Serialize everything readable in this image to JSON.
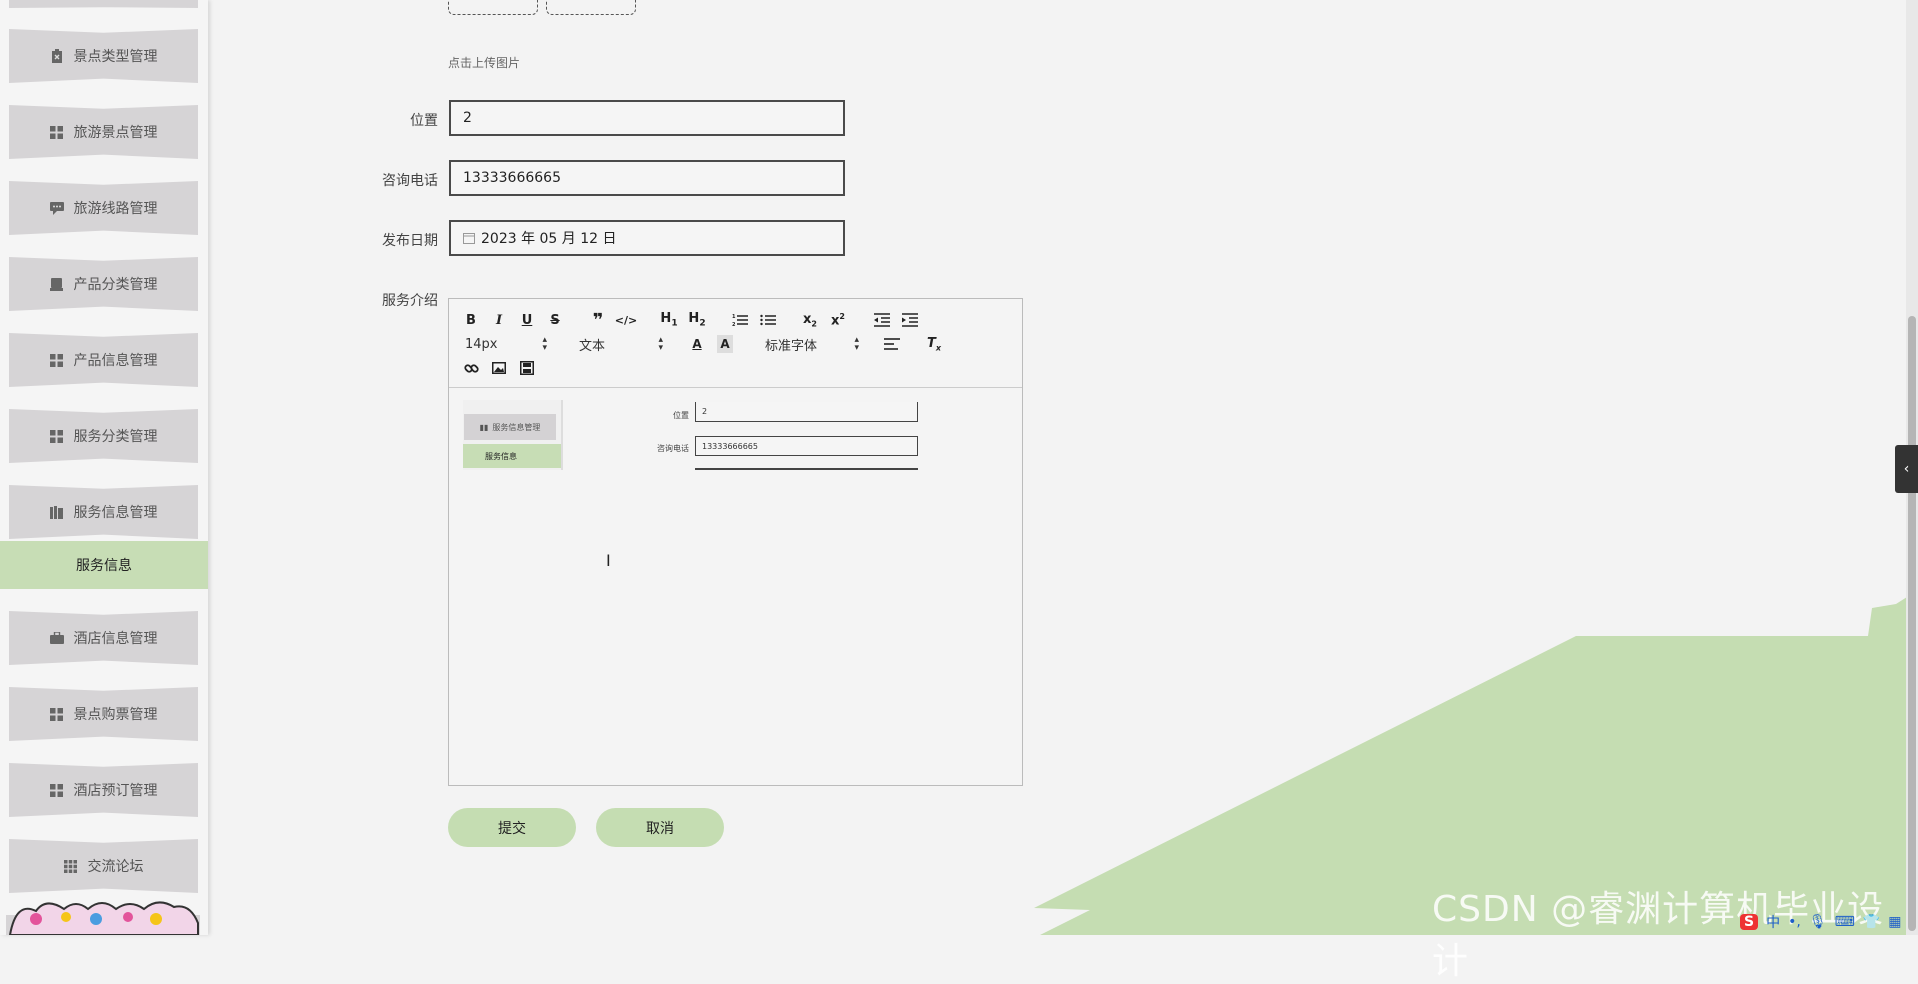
{
  "sidebar": {
    "items": [
      {
        "label": "景点类型管理",
        "icon": "clipboard-icon"
      },
      {
        "label": "旅游景点管理",
        "icon": "grid-icon"
      },
      {
        "label": "旅游线路管理",
        "icon": "comment-icon"
      },
      {
        "label": "产品分类管理",
        "icon": "box-icon"
      },
      {
        "label": "产品信息管理",
        "icon": "grid-icon"
      },
      {
        "label": "服务分类管理",
        "icon": "grid-icon"
      },
      {
        "label": "服务信息管理",
        "icon": "book-icon"
      },
      {
        "label": "酒店信息管理",
        "icon": "briefcase-icon"
      },
      {
        "label": "景点购票管理",
        "icon": "grid-icon"
      },
      {
        "label": "酒店预订管理",
        "icon": "grid-icon"
      },
      {
        "label": "交流论坛",
        "icon": "apps-icon"
      }
    ],
    "active_sub": "服务信息"
  },
  "form": {
    "upload_hint": "点击上传图片",
    "location_label": "位置",
    "location_value": "2",
    "phone_label": "咨询电话",
    "phone_value": "13333666665",
    "date_label": "发布日期",
    "date_value": "2023 年 05 月 12 日",
    "intro_label": "服务介绍"
  },
  "editor": {
    "font_size": "14px",
    "block_format": "文本",
    "font_family": "标准字体",
    "embedded": {
      "menu_item": "服务信息管理",
      "sub_item": "服务信息",
      "location_label": "位置",
      "location_value": "2",
      "phone_label": "咨询电话",
      "phone_value": "13333666665"
    }
  },
  "buttons": {
    "submit": "提交",
    "cancel": "取消"
  },
  "watermark": "CSDN @睿渊计算机毕业设计",
  "tray": {
    "ime_logo": "S",
    "ime_lang": "中"
  },
  "colors": {
    "accent_green": "#c5ddb2",
    "menu_gray": "#d6d4d6"
  }
}
